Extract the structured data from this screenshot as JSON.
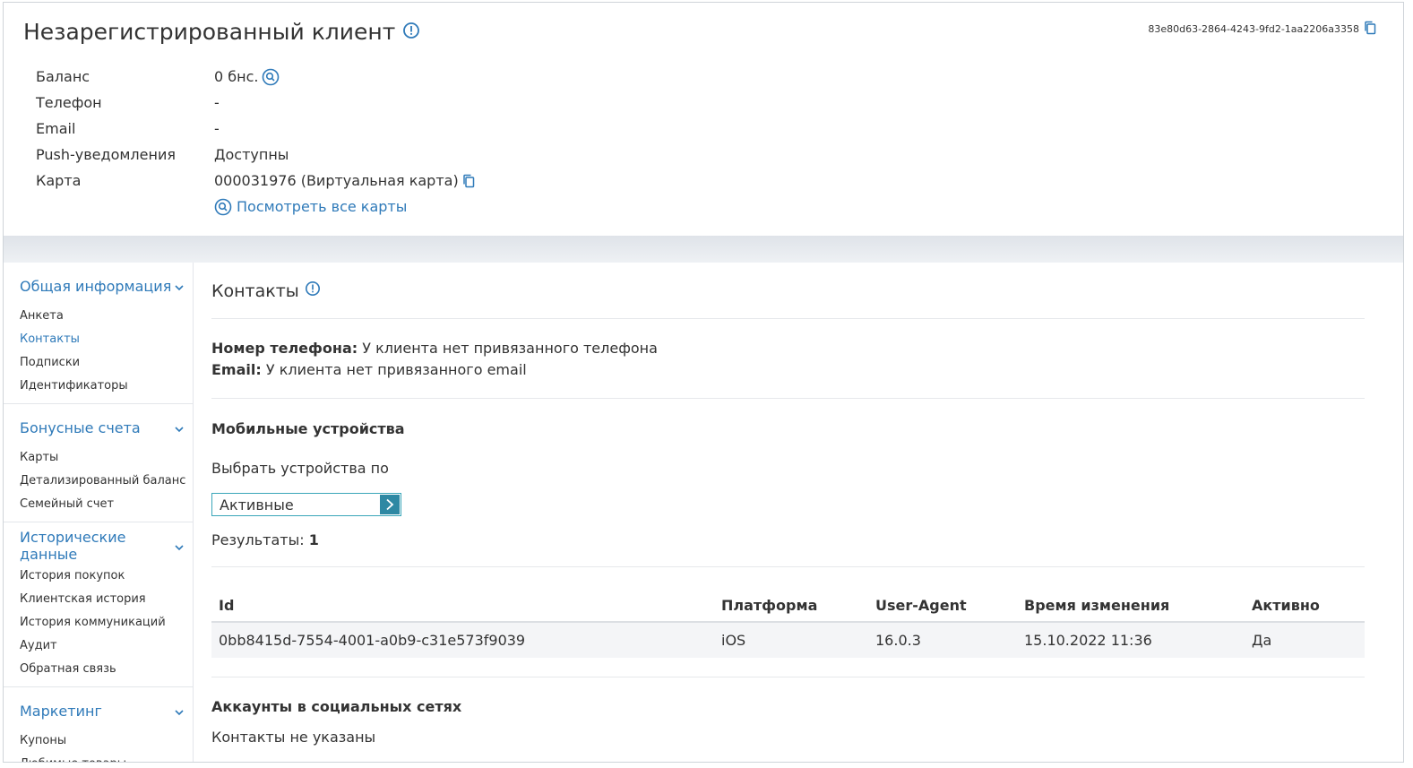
{
  "header": {
    "title": "Незарегистрированный клиент",
    "uuid": "83e80d63-2864-4243-9fd2-1aa2206a3358",
    "properties": [
      {
        "label": "Баланс",
        "value": "0 бнс."
      },
      {
        "label": "Телефон",
        "value": "-"
      },
      {
        "label": "Email",
        "value": "-"
      },
      {
        "label": "Push-уведомления",
        "value": "Доступны"
      },
      {
        "label": "Карта",
        "value": "000031976 (Виртуальная карта)"
      }
    ],
    "view_all_cards": "Посмотреть все карты"
  },
  "sidebar": {
    "groups": [
      {
        "title": "Общая информация",
        "items": [
          "Анкета",
          "Контакты",
          "Подписки",
          "Идентификаторы"
        ]
      },
      {
        "title": "Бонусные счета",
        "items": [
          "Карты",
          "Детализированный баланс",
          "Семейный счет"
        ]
      },
      {
        "title": "Исторические данные",
        "items": [
          "История покупок",
          "Клиентская история",
          "История коммуникаций",
          "Аудит",
          "Обратная связь"
        ]
      },
      {
        "title": "Маркетинг",
        "items": [
          "Купоны",
          "Любимые товары"
        ]
      }
    ]
  },
  "main": {
    "title": "Контакты",
    "phone_label": "Номер телефона:",
    "phone_value": " У клиента нет привязанного телефона",
    "email_label": "Email:",
    "email_value": " У клиента нет привязанного email",
    "devices_title": "Мобильные устройства",
    "filter_label": "Выбрать устройства по",
    "filter_value": "Активные",
    "results_label": "Результаты:",
    "results_count": "1",
    "table": {
      "headers": [
        "Id",
        "Платформа",
        "User-Agent",
        "Время изменения",
        "Активно"
      ],
      "rows": [
        [
          "0bb8415d-7554-4001-a0b9-c31e573f9039",
          "iOS",
          "16.0.3",
          "15.10.2022 11:36",
          "Да"
        ]
      ]
    },
    "social_title": "Аккаунты в социальных сетях",
    "social_value": "Контакты не указаны"
  },
  "colors": {
    "accent": "#2f7ab9",
    "select_border": "#3aa6b9"
  }
}
